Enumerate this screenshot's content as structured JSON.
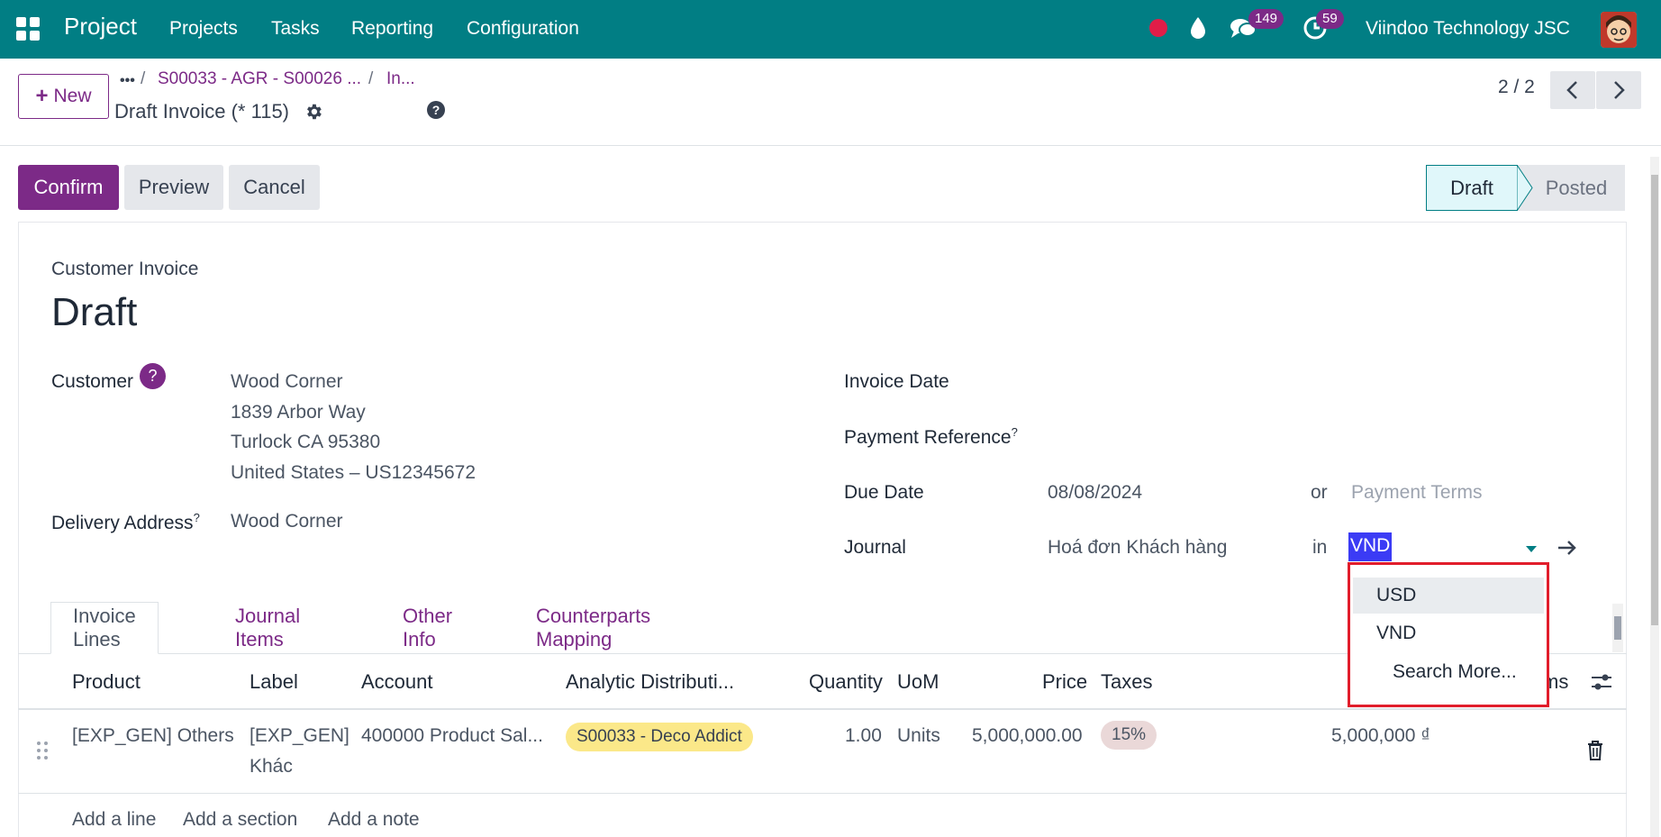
{
  "navbar": {
    "app_name": "Project",
    "menu": [
      "Projects",
      "Tasks",
      "Reporting",
      "Configuration"
    ],
    "messages_count": "149",
    "activities_count": "59",
    "company": "Viindoo Technology JSC"
  },
  "control_panel": {
    "new_label": "New",
    "breadcrumb_ellipsis": "•••",
    "breadcrumb_1": "S00033 - AGR - S00026 ...",
    "breadcrumb_2": "In...",
    "record_title": "Draft Invoice (* 115)",
    "pager": "2 / 2"
  },
  "actions": {
    "confirm": "Confirm",
    "preview": "Preview",
    "cancel": "Cancel"
  },
  "statusbar": {
    "draft": "Draft",
    "posted": "Posted"
  },
  "form": {
    "type": "Customer Invoice",
    "name": "Draft",
    "customer_label": "Customer",
    "customer_help": "?",
    "customer_lines": [
      "Wood Corner",
      "1839 Arbor Way",
      "Turlock CA 95380",
      "United States – US12345672"
    ],
    "delivery_label": "Delivery Address",
    "delivery_value": "Wood Corner",
    "invoice_date_label": "Invoice Date",
    "payment_ref_label": "Payment Reference",
    "due_date_label": "Due Date",
    "due_date_value": "08/08/2024",
    "or_text": "or",
    "payment_terms_placeholder": "Payment Terms",
    "journal_label": "Journal",
    "journal_value": "Hoá đơn Khách hàng",
    "in_text": "in",
    "currency_value": "VND",
    "superscript": "?"
  },
  "currency_dropdown": {
    "options": [
      "USD",
      "VND"
    ],
    "search_more": "Search More..."
  },
  "tabs": [
    "Invoice Lines",
    "Journal Items",
    "Other Info",
    "Counterparts Mapping"
  ],
  "table": {
    "headers": [
      "Product",
      "Label",
      "Account",
      "Analytic Distributi...",
      "Quantity",
      "UoM",
      "Price",
      "Taxes",
      "ms"
    ],
    "row": {
      "product": "[EXP_GEN] Others",
      "label_line1": "[EXP_GEN]",
      "label_line2": "Khác",
      "account": "400000 Product Sal...",
      "analytic": "S00033 - Deco Addict",
      "quantity": "1.00",
      "uom": "Units",
      "price": "5,000,000.00",
      "taxes": "15%",
      "subtotal": "5,000,000 ₫"
    },
    "add_line": "Add a line",
    "add_section": "Add a section",
    "add_note": "Add a note"
  },
  "colors": {
    "navbar": "#017e84",
    "primary": "#7c2a87",
    "highlight_border": "#e11d2b"
  }
}
